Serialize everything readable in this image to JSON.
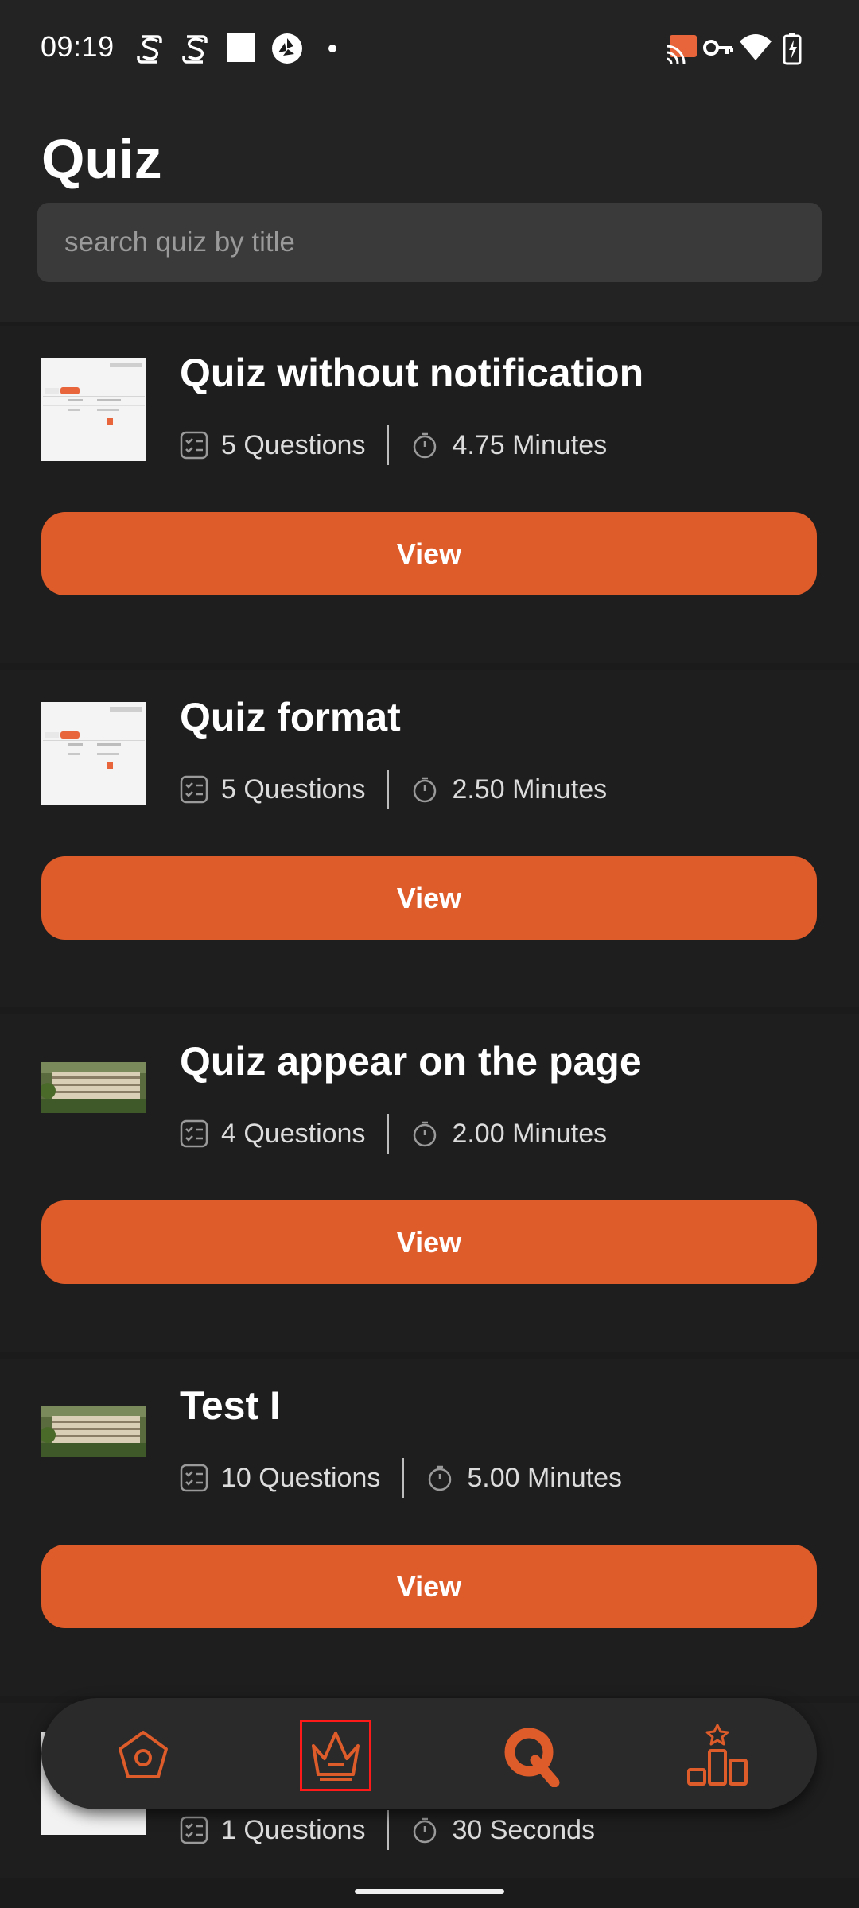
{
  "status_bar": {
    "time": "09:19"
  },
  "header": {
    "title": "Quiz"
  },
  "search": {
    "value": "",
    "placeholder": "search quiz by title"
  },
  "quizzes": [
    {
      "title": "Quiz without notification",
      "questions": "5 Questions",
      "duration": "4.75 Minutes",
      "button": "View"
    },
    {
      "title": "Quiz format",
      "questions": "5 Questions",
      "duration": "2.50 Minutes",
      "button": "View"
    },
    {
      "title": "Quiz appear on the page",
      "questions": "4 Questions",
      "duration": "2.00 Minutes",
      "button": "View"
    },
    {
      "title": "Test I",
      "questions": "10 Questions",
      "duration": "5.00 Minutes",
      "button": "View"
    },
    {
      "questions": "1 Questions",
      "duration": "30 Seconds"
    }
  ],
  "bottom_nav": {
    "items": [
      "home-icon",
      "crown-icon",
      "quiz-q-icon",
      "leaderboard-icon"
    ],
    "selected": "crown-icon"
  },
  "colors": {
    "accent": "#de5b2a",
    "background": "#1b1b1b",
    "header_background": "#232323",
    "search_background": "#3a3a3a",
    "selection_outline": "#ff1a1a"
  }
}
